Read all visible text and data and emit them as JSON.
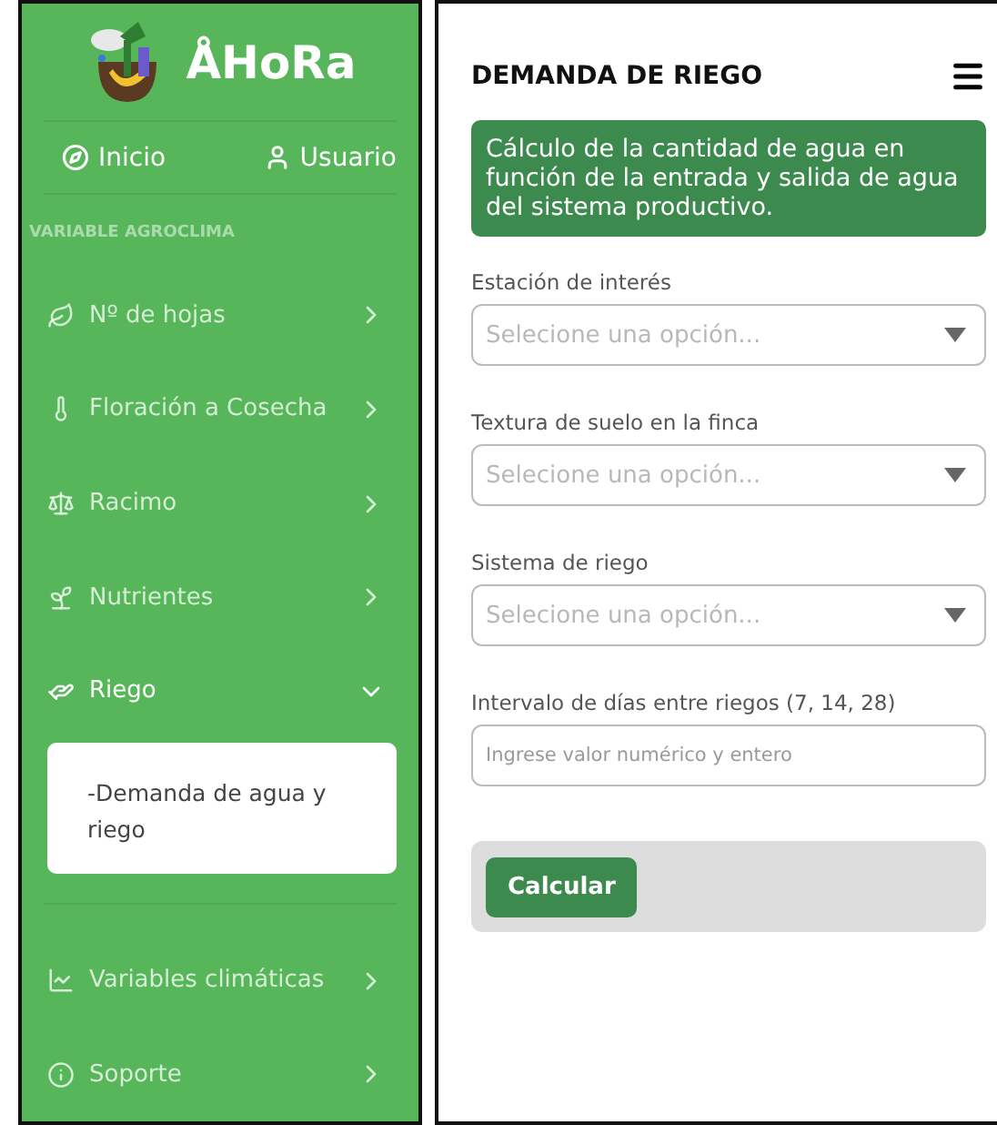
{
  "sidebar": {
    "brand": "ÅHoRa",
    "nav": [
      {
        "label": "Inicio"
      },
      {
        "label": "Usuario"
      }
    ],
    "section": "VARIABLE AGROCLIMA",
    "items": [
      {
        "label": "Nº de hojas",
        "expanded": false
      },
      {
        "label": "Floración a Cosecha",
        "expanded": false
      },
      {
        "label": "Racimo",
        "expanded": false
      },
      {
        "label": "Nutrientes",
        "expanded": false
      },
      {
        "label": "Riego",
        "expanded": true,
        "children": [
          {
            "label": "-Demanda de agua y riego"
          }
        ]
      }
    ],
    "items_bottom": [
      {
        "label": "Variables climáticas",
        "expanded": false
      },
      {
        "label": "Soporte",
        "expanded": false
      }
    ]
  },
  "main": {
    "title": "DEMANDA DE RIEGO",
    "info": "Cálculo de la cantidad de agua en función de la entrada y salida de agua del sistema productivo.",
    "fields": [
      {
        "kind": "select",
        "label": "Estación de interés",
        "placeholder": "Selecione una opción..."
      },
      {
        "kind": "select",
        "label": "Textura de suelo en la finca",
        "placeholder": "Selecione una opción..."
      },
      {
        "kind": "select",
        "label": "Sistema de riego",
        "placeholder": "Selecione una opción..."
      },
      {
        "kind": "input",
        "label": "Intervalo de días entre riegos (7, 14, 28)",
        "placeholder": "Ingrese valor numérico y entero"
      }
    ],
    "button": "Calcular"
  }
}
